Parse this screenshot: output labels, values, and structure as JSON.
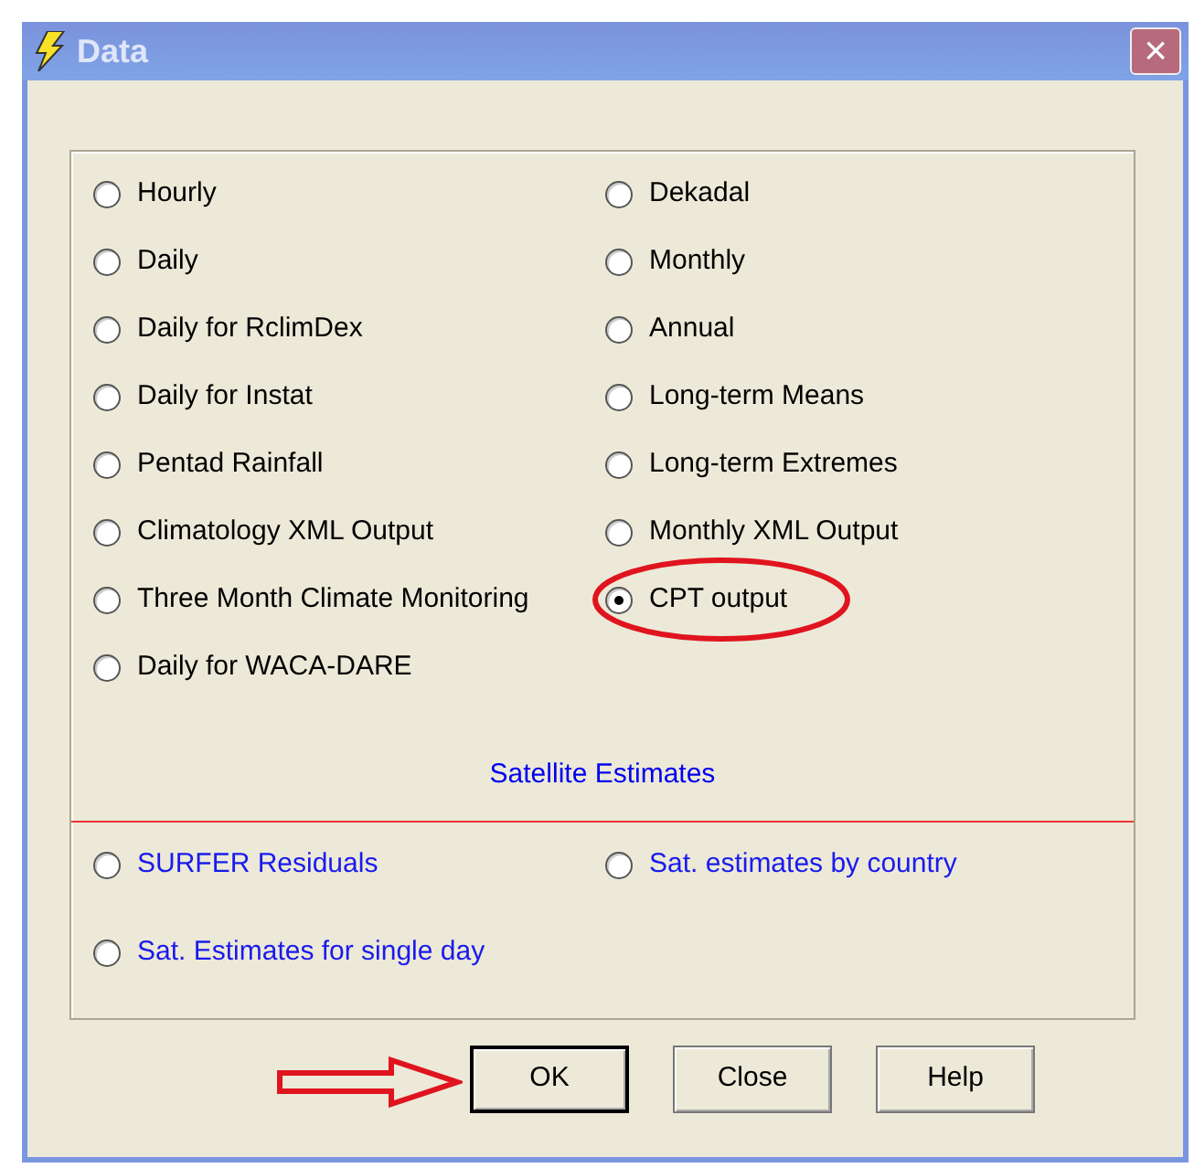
{
  "window": {
    "title": "Data",
    "close_label": "×"
  },
  "options": [
    {
      "label": "Hourly",
      "selected": false
    },
    {
      "label": "Dekadal",
      "selected": false
    },
    {
      "label": "Daily",
      "selected": false
    },
    {
      "label": "Monthly",
      "selected": false
    },
    {
      "label": "Daily for RclimDex",
      "selected": false
    },
    {
      "label": "Annual",
      "selected": false
    },
    {
      "label": "Daily for Instat",
      "selected": false
    },
    {
      "label": "Long-term Means",
      "selected": false
    },
    {
      "label": "Pentad Rainfall",
      "selected": false
    },
    {
      "label": "Long-term Extremes",
      "selected": false
    },
    {
      "label": "Climatology XML Output",
      "selected": false
    },
    {
      "label": "Monthly XML Output",
      "selected": false
    },
    {
      "label": "Three Month Climate Monitoring",
      "selected": false
    },
    {
      "label": "CPT output",
      "selected": true
    },
    {
      "label": "Daily for WACA-DARE",
      "selected": false
    }
  ],
  "section_label": "Satellite Estimates",
  "satellite_options": [
    {
      "label": "SURFER Residuals",
      "selected": false
    },
    {
      "label": "Sat. estimates by country",
      "selected": false
    },
    {
      "label": "Sat. Estimates for single day",
      "selected": false
    }
  ],
  "buttons": [
    {
      "label": "OK",
      "default": true
    },
    {
      "label": "Close",
      "default": false
    },
    {
      "label": "Help",
      "default": false
    }
  ]
}
